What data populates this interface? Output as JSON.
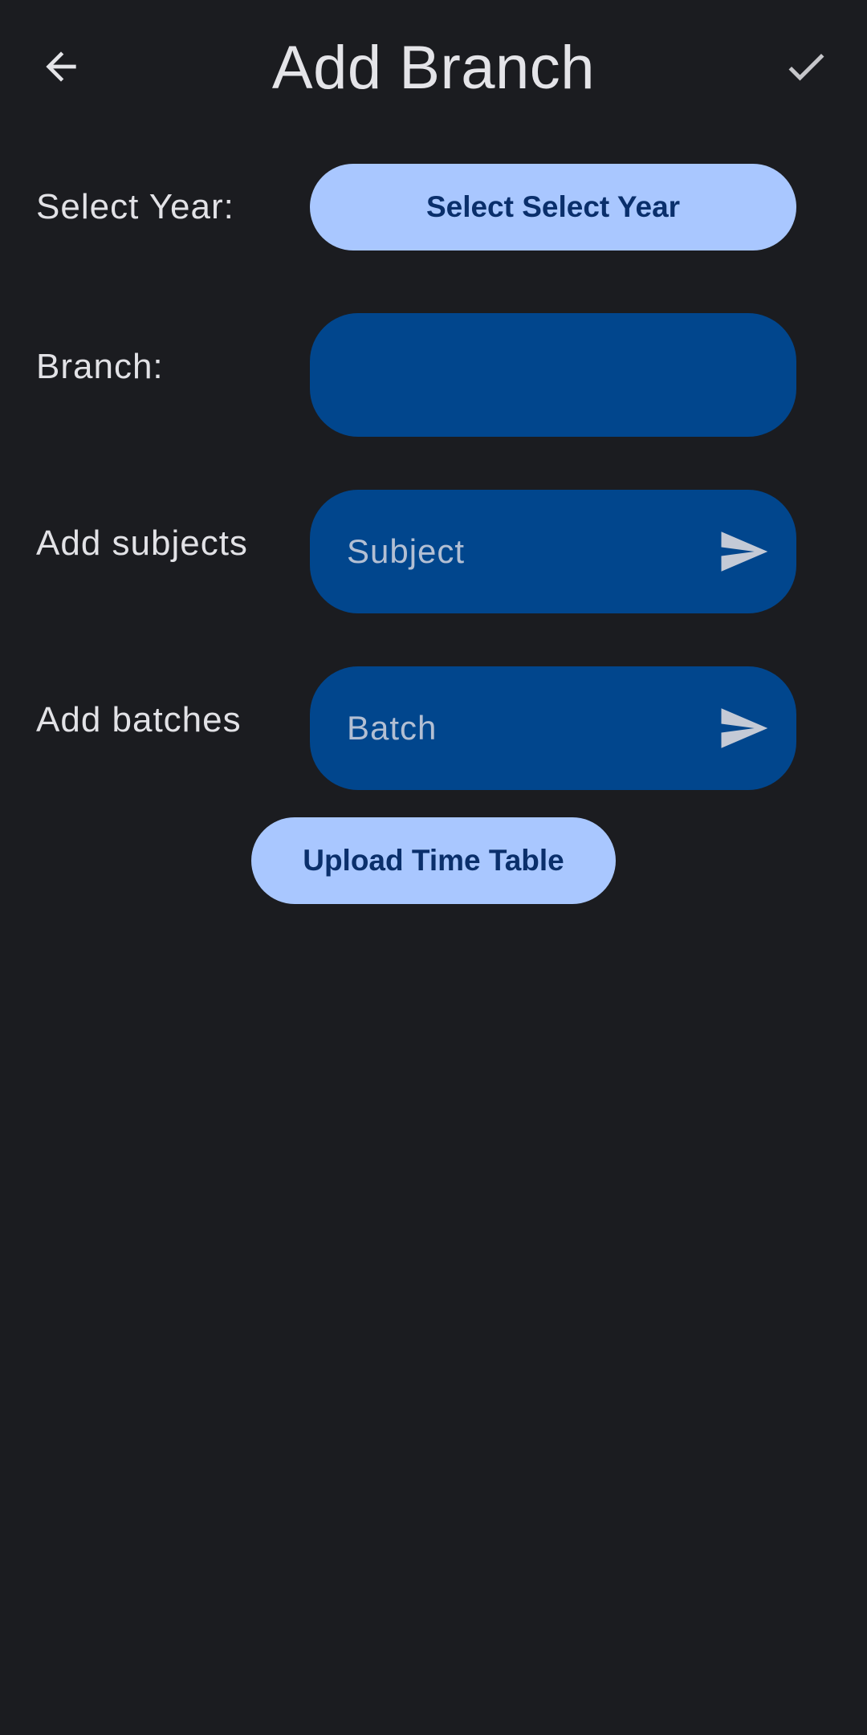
{
  "header": {
    "title": "Add Branch",
    "back_icon": "arrow-left-icon",
    "confirm_icon": "check-icon"
  },
  "form": {
    "year": {
      "label": "Select Year:",
      "button_label": "Select Select Year"
    },
    "branch": {
      "label": "Branch:",
      "value": ""
    },
    "subjects": {
      "label": "Add subjects",
      "placeholder": "Subject",
      "send_icon": "send-icon"
    },
    "batches": {
      "label": "Add batches",
      "placeholder": "Batch",
      "send_icon": "send-icon"
    },
    "upload_label": "Upload Time Table"
  },
  "colors": {
    "background": "#1b1c20",
    "primary_container": "#a9c7ff",
    "field_fill": "#01468d",
    "on_surface": "#e4e4e8"
  }
}
